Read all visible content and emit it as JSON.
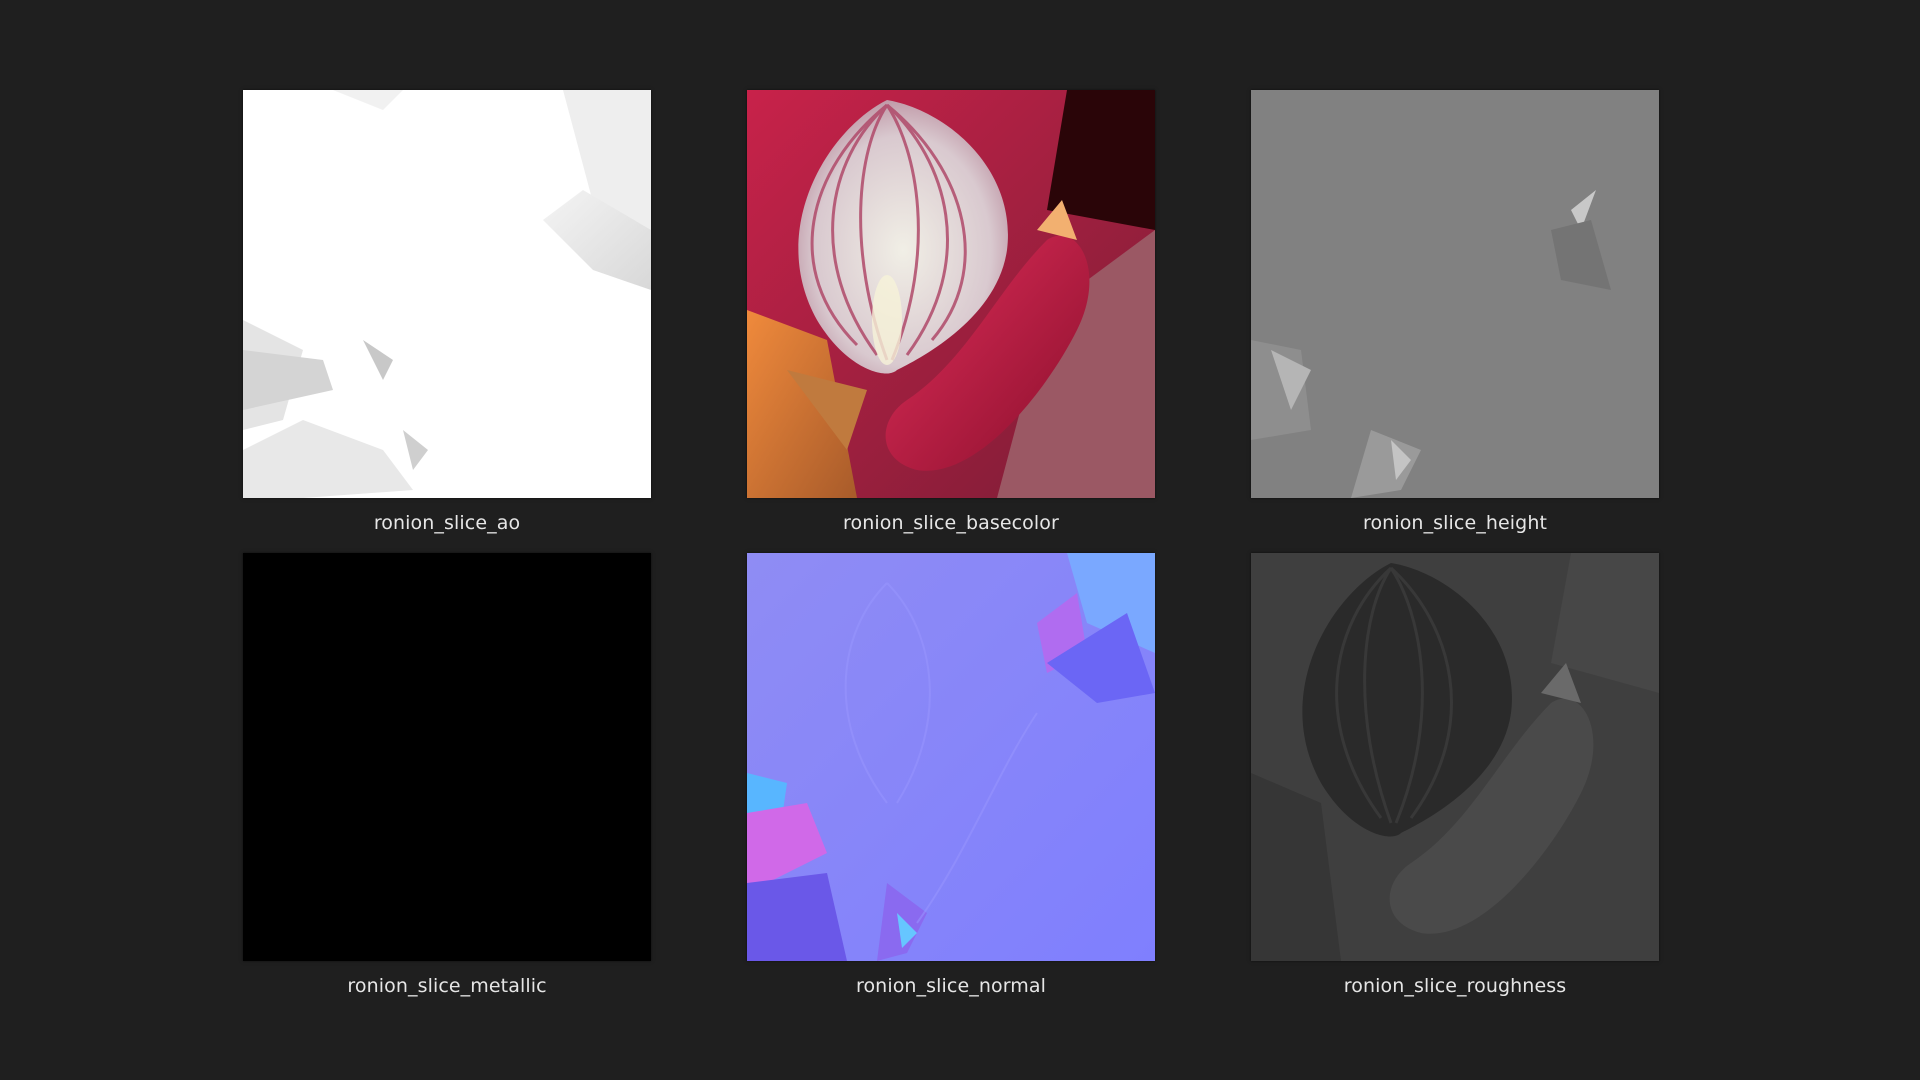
{
  "gallery": {
    "background": "#1f1f1f",
    "caption_color": "#e6e6e6",
    "items": [
      {
        "name": "ronion_slice_ao",
        "icon": "ambient-occlusion-map-thumbnail"
      },
      {
        "name": "ronion_slice_basecolor",
        "icon": "basecolor-map-thumbnail"
      },
      {
        "name": "ronion_slice_height",
        "icon": "height-map-thumbnail"
      },
      {
        "name": "ronion_slice_metallic",
        "icon": "metallic-map-thumbnail"
      },
      {
        "name": "ronion_slice_normal",
        "icon": "normal-map-thumbnail"
      },
      {
        "name": "ronion_slice_roughness",
        "icon": "roughness-map-thumbnail"
      }
    ]
  }
}
